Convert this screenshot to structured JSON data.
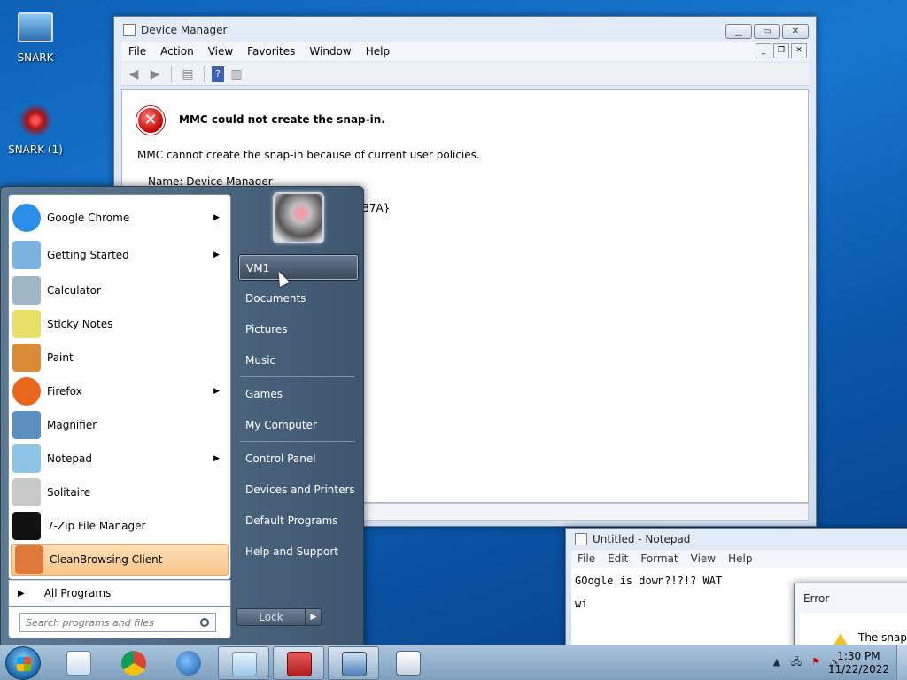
{
  "desktop": {
    "icons": [
      {
        "label": "SNARK"
      },
      {
        "label": "SNARK (1)"
      }
    ]
  },
  "device_manager": {
    "title": "Device Manager",
    "menu": [
      "File",
      "Action",
      "View",
      "Favorites",
      "Window",
      "Help"
    ],
    "error_title": "MMC could not create the snap-in.",
    "error_message": "MMC cannot create the snap-in because of current user policies.",
    "name_line": "Name: Device Manager",
    "clsid_fragment": "0B7A}"
  },
  "start_menu": {
    "programs": [
      {
        "label": "Google Chrome",
        "icon": "chrome-icon",
        "color": "#2a8de8",
        "arrow": true
      },
      {
        "label": "Getting Started",
        "icon": "getting-started-icon",
        "color": "#7bb3e0",
        "arrow": true
      },
      {
        "label": "Calculator",
        "icon": "calculator-icon",
        "color": "#9fb6c7",
        "arrow": false
      },
      {
        "label": "Sticky Notes",
        "icon": "sticky-notes-icon",
        "color": "#e9e06a",
        "arrow": false
      },
      {
        "label": "Paint",
        "icon": "paint-icon",
        "color": "#d98b3a",
        "arrow": false
      },
      {
        "label": "Firefox",
        "icon": "firefox-icon",
        "color": "#e8671d",
        "arrow": true
      },
      {
        "label": "Magnifier",
        "icon": "magnifier-icon",
        "color": "#5b8fbf",
        "arrow": false
      },
      {
        "label": "Notepad",
        "icon": "notepad-icon",
        "color": "#8ec5e6",
        "arrow": true
      },
      {
        "label": "Solitaire",
        "icon": "solitaire-icon",
        "color": "#c9c9c9",
        "arrow": false
      },
      {
        "label": "7-Zip File Manager",
        "icon": "seven-zip-icon",
        "color": "#111111",
        "arrow": false
      },
      {
        "label": "CleanBrowsing Client",
        "icon": "cleanbrowsing-icon",
        "color": "#e07a3c",
        "arrow": false,
        "highlighted": true
      }
    ],
    "all_programs": "All Programs",
    "search_placeholder": "Search programs and files",
    "places": [
      {
        "label": "VM1",
        "highlighted": true
      },
      {
        "label": "Documents"
      },
      {
        "label": "Pictures"
      },
      {
        "label": "Music"
      },
      {
        "label": "Games"
      },
      {
        "label": "My Computer"
      },
      {
        "label": "Control Panel"
      },
      {
        "label": "Devices and Printers"
      },
      {
        "label": "Default Programs"
      },
      {
        "label": "Help and Support"
      }
    ],
    "lock_label": "Lock"
  },
  "notepad": {
    "title": "Untitled - Notepad",
    "menu": [
      "File",
      "Edit",
      "Format",
      "View",
      "Help"
    ],
    "lines": [
      "GOogle is down?!?!? WAT",
      "wi"
    ]
  },
  "error_dialog": {
    "title": "Error",
    "text": "The snap-i"
  },
  "taskbar": {
    "clock_time": "1:30 PM",
    "clock_date": "11/22/2022"
  }
}
